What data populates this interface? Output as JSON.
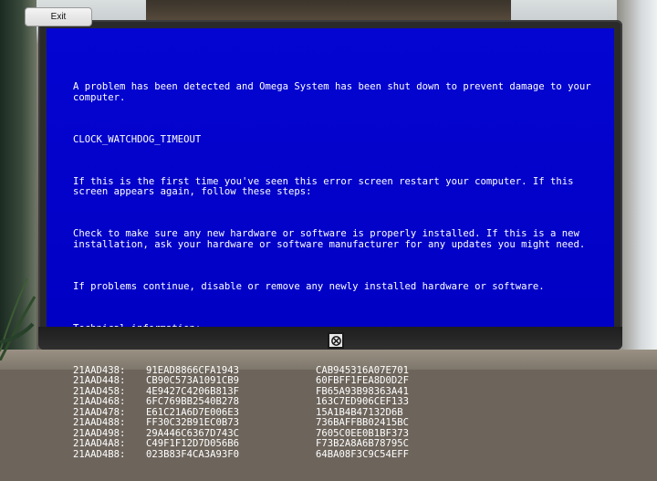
{
  "exit_button": {
    "label": "Exit"
  },
  "colors": {
    "screen_blue": "#0000c8",
    "text": "#ffffff"
  },
  "bsod": {
    "intro": "A problem has been detected and Omega System has been shut down to prevent damage to your computer.",
    "error_code": "CLOCK_WATCHDOG_TIMEOUT",
    "first_time": "If this is the first time you've seen this error screen restart your computer. If this screen appears again, follow these steps:",
    "check": "Check to make sure any new hardware or software is properly installed. If this is a new installation, ask your hardware or software manufacturer for any updates you might need.",
    "continue": "If problems continue, disable or remove any newly installed hardware or software.",
    "tech_header": "Technical information:",
    "tech_rows": [
      {
        "addr": "21AAD438:",
        "v1": "91EAD8866CFA1943",
        "v2": "CAB945316A07E701"
      },
      {
        "addr": "21AAD448:",
        "v1": "CB90C573A1091CB9",
        "v2": "60FBFF1FEA8D0D2F"
      },
      {
        "addr": "21AAD458:",
        "v1": "4E9427C4206B813F",
        "v2": "FB65A93B98363A41"
      },
      {
        "addr": "21AAD468:",
        "v1": "6FC769BB2540B278",
        "v2": "163C7ED906CEF133"
      },
      {
        "addr": "21AAD478:",
        "v1": "E61C21A6D7E006E3",
        "v2": "15A1B4B47132D6B"
      },
      {
        "addr": "21AAD488:",
        "v1": "FF30C32B91EC0B73",
        "v2": "736BAFFBB02415BC"
      },
      {
        "addr": "21AAD498:",
        "v1": "29A446C6367D743C",
        "v2": "7605C0EE0B1BF373"
      },
      {
        "addr": "21AAD4A8:",
        "v1": "C49F1F12D7D056B6",
        "v2": "F73B2A8A6B78795C"
      },
      {
        "addr": "21AAD4B8:",
        "v1": "023B83F4CA3A93F0",
        "v2": "64BA08F3C9C54EFF"
      }
    ]
  },
  "icons": {
    "power": "power-button-icon"
  }
}
